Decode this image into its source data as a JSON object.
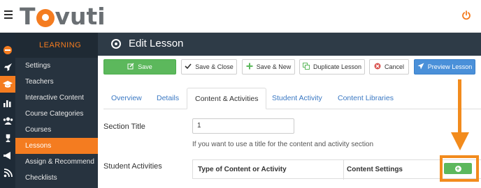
{
  "app": {
    "logo_text_left": "T",
    "logo_text_right": "vuti"
  },
  "sidebar": {
    "section_title": "LEARNING",
    "items": [
      {
        "label": "Settings"
      },
      {
        "label": "Teachers"
      },
      {
        "label": "Interactive Content"
      },
      {
        "label": "Course Categories"
      },
      {
        "label": "Courses"
      },
      {
        "label": "Lessons",
        "active": true
      },
      {
        "label": "Assign & Recommend"
      },
      {
        "label": "Checklists"
      }
    ]
  },
  "header": {
    "title": "Edit Lesson"
  },
  "toolbar": {
    "save": "Save",
    "save_close": "Save & Close",
    "save_new": "Save & New",
    "duplicate": "Duplicate Lesson",
    "cancel": "Cancel",
    "preview": "Preview Lesson"
  },
  "tabs": [
    {
      "label": "Overview"
    },
    {
      "label": "Details"
    },
    {
      "label": "Content & Activities",
      "active": true
    },
    {
      "label": "Student Activity"
    },
    {
      "label": "Content Libraries"
    }
  ],
  "form": {
    "section_title_label": "Section Title",
    "section_title_value": "1",
    "section_title_help": "If you want to use a title for the content and activity section",
    "student_activities_label": "Student Activities",
    "table": {
      "col_type": "Type of Content or Activity",
      "col_settings": "Content Settings"
    }
  },
  "colors": {
    "accent": "#f47c20",
    "sidebar_bg": "#27333f",
    "header_bg": "#2e3b47",
    "save_green": "#5cb85c",
    "preview_blue": "#4a90d9",
    "tab_link": "#3a78c3",
    "highlight": "#f28b1d"
  }
}
